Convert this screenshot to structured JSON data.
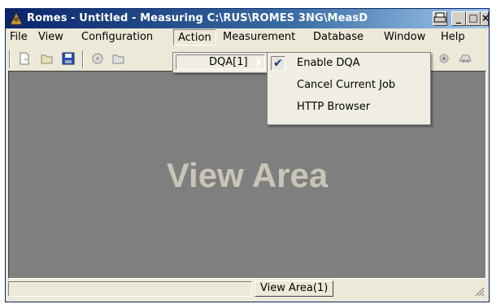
{
  "window": {
    "title": "Romes - Untitled - Measuring C:\\RUS\\ROMES 3NG\\MeasD",
    "buttons": {
      "minimize": "_",
      "maximize": "□",
      "close": "×"
    }
  },
  "menubar": {
    "items": [
      "File",
      "View",
      "Configuration",
      "Action",
      "Measurement",
      "Database",
      "Window",
      "Help"
    ],
    "active": "Action"
  },
  "submenu": {
    "label": "DQA[1]"
  },
  "flyout": {
    "items": [
      {
        "label": "Enable DQA",
        "checked": true
      },
      {
        "label": "Cancel Current Job",
        "checked": false
      },
      {
        "label": "HTTP Browser",
        "checked": false
      }
    ]
  },
  "view_area": {
    "label": "View Area"
  },
  "statusbar": {
    "tab_label": "View Area(1)"
  },
  "colors": {
    "title_active": "#0a246a",
    "view_bg": "#7f7f7f",
    "menu_bg": "#ece9d8"
  },
  "icons": [
    "new-document-icon",
    "open-folder-icon",
    "save-disk-icon",
    "record-icon",
    "open-file-icon",
    "settings-gear-icon",
    "log-icon"
  ]
}
